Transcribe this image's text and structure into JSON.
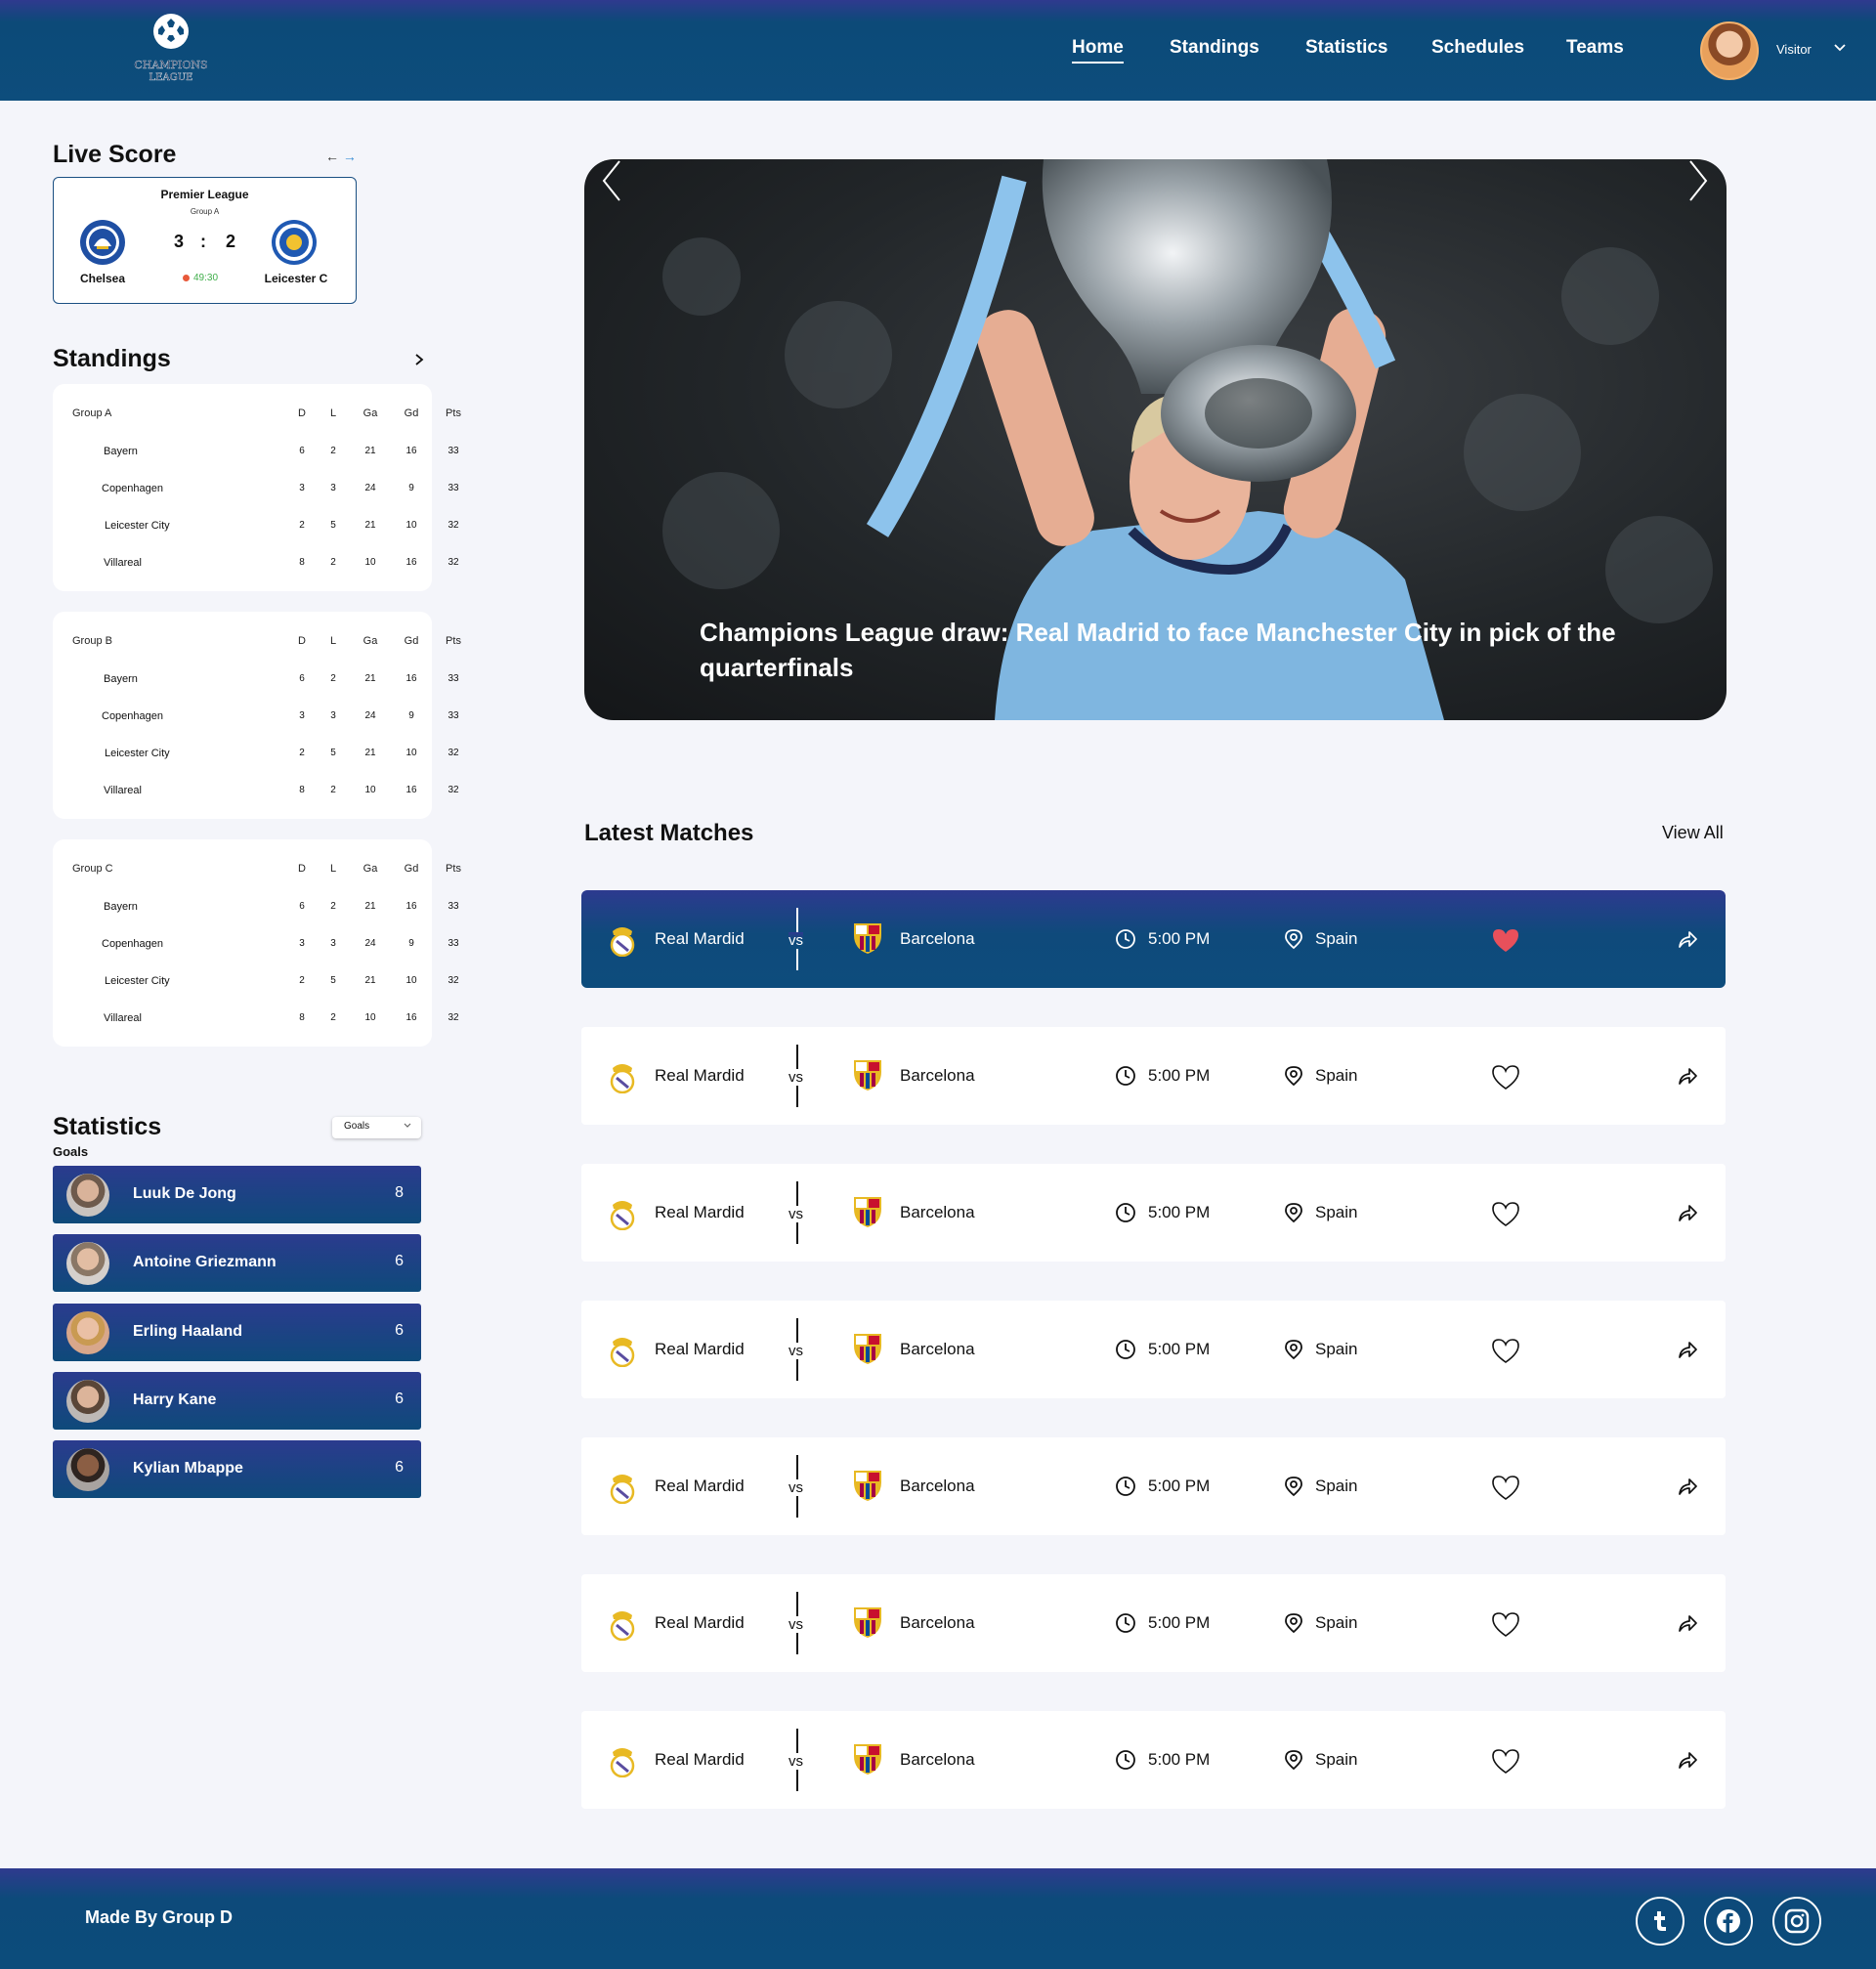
{
  "header": {
    "logo_text": "CHAMPIONS LEAGUE",
    "nav": [
      "Home",
      "Standings",
      "Statistics",
      "Schedules",
      "Teams"
    ],
    "active_nav": "Home",
    "user_label": "Visitor"
  },
  "live_score": {
    "title": "Live Score",
    "league": "Premier League",
    "group": "Group A",
    "home_team": "Chelsea",
    "away_team": "Leicester C",
    "home_score": "3",
    "separator": ":",
    "away_score": "2",
    "time": "49:30"
  },
  "standings": {
    "title": "Standings",
    "columns": [
      "D",
      "L",
      "Ga",
      "Gd",
      "Pts"
    ],
    "groups": [
      {
        "name": "Group A",
        "rows": [
          {
            "team": "Bayern",
            "d": "6",
            "l": "2",
            "ga": "21",
            "gd": "16",
            "pts": "33"
          },
          {
            "team": "Copenhagen",
            "d": "3",
            "l": "3",
            "ga": "24",
            "gd": "9",
            "pts": "33"
          },
          {
            "team": "Leicester City",
            "d": "2",
            "l": "5",
            "ga": "21",
            "gd": "10",
            "pts": "32"
          },
          {
            "team": "Villareal",
            "d": "8",
            "l": "2",
            "ga": "10",
            "gd": "16",
            "pts": "32"
          }
        ]
      },
      {
        "name": "Group B",
        "rows": [
          {
            "team": "Bayern",
            "d": "6",
            "l": "2",
            "ga": "21",
            "gd": "16",
            "pts": "33"
          },
          {
            "team": "Copenhagen",
            "d": "3",
            "l": "3",
            "ga": "24",
            "gd": "9",
            "pts": "33"
          },
          {
            "team": "Leicester City",
            "d": "2",
            "l": "5",
            "ga": "21",
            "gd": "10",
            "pts": "32"
          },
          {
            "team": "Villareal",
            "d": "8",
            "l": "2",
            "ga": "10",
            "gd": "16",
            "pts": "32"
          }
        ]
      },
      {
        "name": "Group C",
        "rows": [
          {
            "team": "Bayern",
            "d": "6",
            "l": "2",
            "ga": "21",
            "gd": "16",
            "pts": "33"
          },
          {
            "team": "Copenhagen",
            "d": "3",
            "l": "3",
            "ga": "24",
            "gd": "9",
            "pts": "33"
          },
          {
            "team": "Leicester City",
            "d": "2",
            "l": "5",
            "ga": "21",
            "gd": "10",
            "pts": "32"
          },
          {
            "team": "Villareal",
            "d": "8",
            "l": "2",
            "ga": "10",
            "gd": "16",
            "pts": "32"
          }
        ]
      }
    ]
  },
  "statistics": {
    "title": "Statistics",
    "selected": "Goals",
    "label": "Goals",
    "players": [
      {
        "name": "Luuk De Jong",
        "value": "8"
      },
      {
        "name": "Antoine Griezmann",
        "value": "6"
      },
      {
        "name": "Erling Haaland",
        "value": "6"
      },
      {
        "name": "Harry Kane",
        "value": "6"
      },
      {
        "name": "Kylian Mbappe",
        "value": "6"
      }
    ]
  },
  "hero": {
    "caption": "Champions League draw: Real Madrid to face Manchester City in pick of the quarterfinals"
  },
  "latest_matches": {
    "title": "Latest Matches",
    "view_all": "View All",
    "matches": [
      {
        "home": "Real Mardid",
        "vs": "vs",
        "away": "Barcelona",
        "time": "5:00 PM",
        "place": "Spain",
        "favorite": true
      },
      {
        "home": "Real Mardid",
        "vs": "vs",
        "away": "Barcelona",
        "time": "5:00 PM",
        "place": "Spain",
        "favorite": false
      },
      {
        "home": "Real Mardid",
        "vs": "vs",
        "away": "Barcelona",
        "time": "5:00 PM",
        "place": "Spain",
        "favorite": false
      },
      {
        "home": "Real Mardid",
        "vs": "vs",
        "away": "Barcelona",
        "time": "5:00 PM",
        "place": "Spain",
        "favorite": false
      },
      {
        "home": "Real Mardid",
        "vs": "vs",
        "away": "Barcelona",
        "time": "5:00 PM",
        "place": "Spain",
        "favorite": false
      },
      {
        "home": "Real Mardid",
        "vs": "vs",
        "away": "Barcelona",
        "time": "5:00 PM",
        "place": "Spain",
        "favorite": false
      },
      {
        "home": "Real Mardid",
        "vs": "vs",
        "away": "Barcelona",
        "time": "5:00 PM",
        "place": "Spain",
        "favorite": false
      }
    ]
  },
  "footer": {
    "text": "Made By Group D",
    "social": [
      "tumblr-icon",
      "facebook-icon",
      "instagram-icon"
    ]
  },
  "colors": {
    "brand_navy": "#0d4c7c",
    "brand_indigo": "#2f3a8f",
    "favorite_red": "#e8505b",
    "live_green": "#3fae4a"
  }
}
